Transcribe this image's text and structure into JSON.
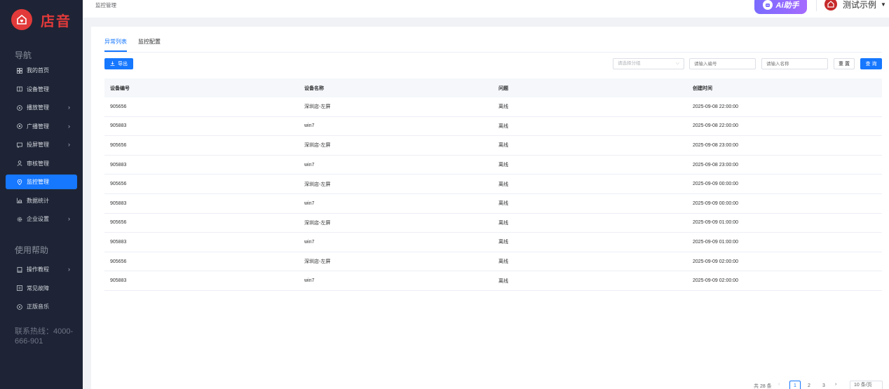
{
  "brand": {
    "name": "店音",
    "logo_icon": "home-heart-icon",
    "color": "#e23a3a"
  },
  "sidebar": {
    "section_nav": "导航",
    "items": [
      {
        "label": "我的首页",
        "icon": "grid-icon",
        "arrow": ""
      },
      {
        "label": "设备管理",
        "icon": "device-icon",
        "arrow": ""
      },
      {
        "label": "播放管理",
        "icon": "play-icon",
        "arrow": "›"
      },
      {
        "label": "广播管理",
        "icon": "broadcast-icon",
        "arrow": "›"
      },
      {
        "label": "投屏管理",
        "icon": "cast-icon",
        "arrow": "›"
      },
      {
        "label": "审核管理",
        "icon": "user-check-icon",
        "arrow": ""
      },
      {
        "label": "监控管理",
        "icon": "location-icon",
        "arrow": ""
      },
      {
        "label": "数据统计",
        "icon": "chart-icon",
        "arrow": ""
      },
      {
        "label": "企业设置",
        "icon": "gear-icon",
        "arrow": "›"
      }
    ],
    "section_help": "使用帮助",
    "help_items": [
      {
        "label": "操作教程",
        "icon": "book-icon",
        "arrow": "›"
      },
      {
        "label": "常见故障",
        "icon": "fault-icon",
        "arrow": ""
      },
      {
        "label": "正版音乐",
        "icon": "music-icon",
        "arrow": ""
      }
    ],
    "hotline": "联系热线：4000-666-901",
    "active_color": "#1677ff"
  },
  "header": {
    "breadcrumb": "监控管理",
    "ai_button": "Ai助手",
    "user_name": "测试示例"
  },
  "tabs": [
    {
      "label": "异常列表",
      "active": true
    },
    {
      "label": "监控配置",
      "active": false
    }
  ],
  "toolbar": {
    "export_label": "导出",
    "group_placeholder": "请选择分组",
    "code_placeholder": "请输入编号",
    "name_placeholder": "请输入名称",
    "reset_label": "重 置",
    "query_label": "查 询"
  },
  "table": {
    "columns": [
      "设备编号",
      "设备名称",
      "问题",
      "创建时间"
    ],
    "rows": [
      [
        "905656",
        "深圳店-左屏",
        "离线",
        "2025-09-08 22:00:00"
      ],
      [
        "905883",
        "win7",
        "离线",
        "2025-09-08 22:00:00"
      ],
      [
        "905656",
        "深圳店-左屏",
        "离线",
        "2025-09-08 23:00:00"
      ],
      [
        "905883",
        "win7",
        "离线",
        "2025-09-08 23:00:00"
      ],
      [
        "905656",
        "深圳店-左屏",
        "离线",
        "2025-09-09 00:00:00"
      ],
      [
        "905883",
        "win7",
        "离线",
        "2025-09-09 00:00:00"
      ],
      [
        "905656",
        "深圳店-左屏",
        "离线",
        "2025-09-09 01:00:00"
      ],
      [
        "905883",
        "win7",
        "离线",
        "2025-09-09 01:00:00"
      ],
      [
        "905656",
        "深圳店-左屏",
        "离线",
        "2025-09-09 02:00:00"
      ],
      [
        "905883",
        "win7",
        "离线",
        "2025-09-09 02:00:00"
      ]
    ]
  },
  "pagination": {
    "total": "共 28 条",
    "pages": [
      "1",
      "2",
      "3"
    ],
    "current": "1",
    "page_size": "10 条/页"
  }
}
